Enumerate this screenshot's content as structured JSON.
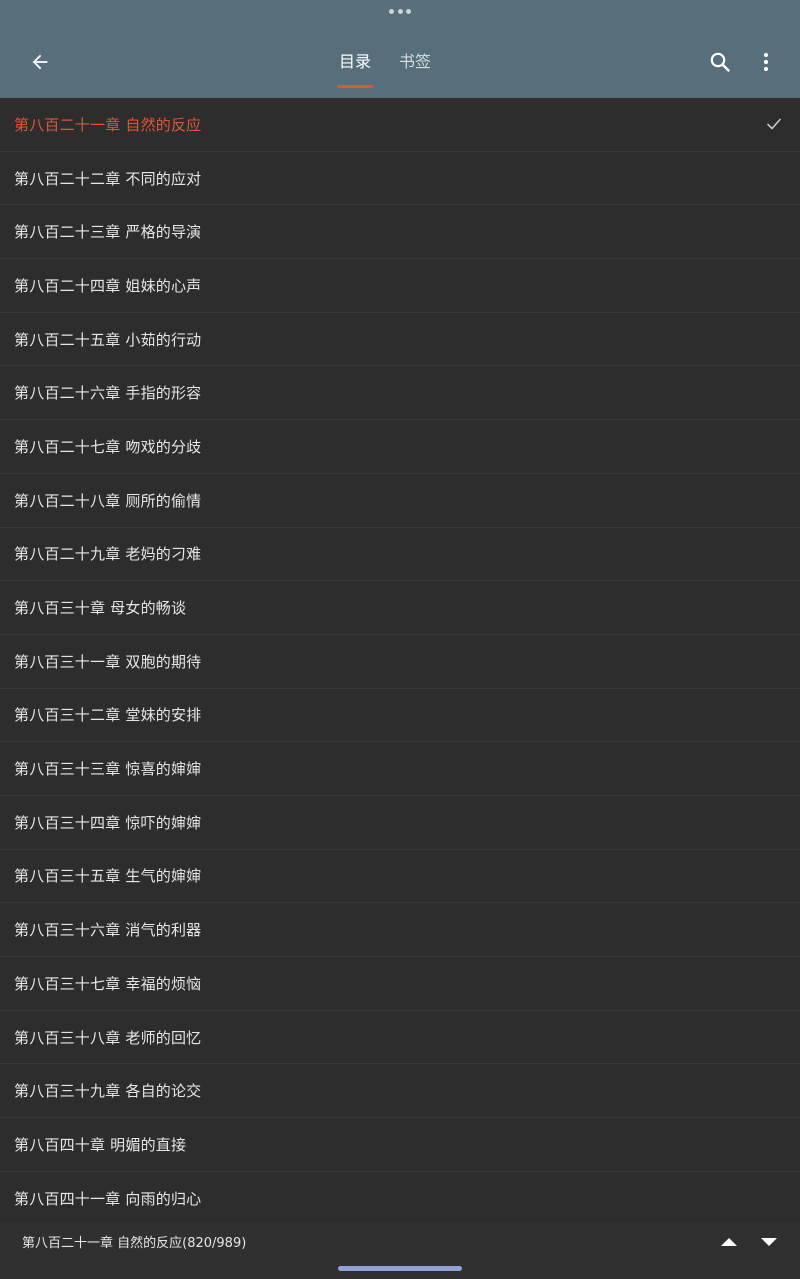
{
  "header": {
    "tabs": [
      {
        "label": "目录",
        "active": true
      },
      {
        "label": "书签",
        "active": false
      }
    ],
    "icons": {
      "back": "arrow-left-icon",
      "search": "search-icon",
      "more": "more-vertical-icon"
    },
    "accent_color": "#e0543b",
    "background_color": "#576f7b"
  },
  "chapters": [
    {
      "title": "第八百二十一章 自然的反应",
      "current": true
    },
    {
      "title": "第八百二十二章 不同的应对"
    },
    {
      "title": "第八百二十三章 严格的导演"
    },
    {
      "title": "第八百二十四章 姐妹的心声"
    },
    {
      "title": "第八百二十五章 小茹的行动"
    },
    {
      "title": "第八百二十六章 手指的形容"
    },
    {
      "title": "第八百二十七章 吻戏的分歧"
    },
    {
      "title": "第八百二十八章 厕所的偷情"
    },
    {
      "title": "第八百二十九章 老妈的刁难"
    },
    {
      "title": "第八百三十章 母女的畅谈"
    },
    {
      "title": "第八百三十一章 双胞的期待"
    },
    {
      "title": "第八百三十二章 堂妹的安排"
    },
    {
      "title": "第八百三十三章 惊喜的婶婶"
    },
    {
      "title": "第八百三十四章 惊吓的婶婶"
    },
    {
      "title": "第八百三十五章 生气的婶婶"
    },
    {
      "title": "第八百三十六章 消气的利器"
    },
    {
      "title": "第八百三十七章 幸福的烦恼"
    },
    {
      "title": "第八百三十八章 老师的回忆"
    },
    {
      "title": "第八百三十九章 各自的论交"
    },
    {
      "title": "第八百四十章 明媚的直接"
    },
    {
      "title": "第八百四十一章 向雨的归心"
    }
  ],
  "bottom_bar": {
    "current_chapter": "第八百二十一章 自然的反应",
    "progress": "(820/989)",
    "icons": {
      "up": "triangle-up-icon",
      "down": "triangle-down-icon"
    }
  }
}
